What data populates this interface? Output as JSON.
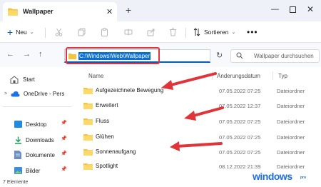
{
  "tab": {
    "title": "Wallpaper",
    "close": "✕",
    "add": "+"
  },
  "window": {
    "minimize": "—",
    "close": "✕"
  },
  "toolbar": {
    "new_label": "Neu",
    "new_icon": "+",
    "new_caret": "⌄",
    "sort_label": "Sortieren",
    "sort_caret": "⌄",
    "more": "•••",
    "icons": [
      "scissors-icon",
      "copy-icon",
      "paste-icon",
      "rename-icon",
      "share-icon",
      "delete-icon",
      "sort-icon"
    ]
  },
  "nav": {
    "back": "←",
    "forward": "→",
    "up": "↑",
    "address": "C:\\Windows\\Web\\Wallpaper",
    "refresh": "↻",
    "search_placeholder": "Wallpaper durchsuchen"
  },
  "sidebar": {
    "items": [
      {
        "label": "Start",
        "icon": "home-icon"
      },
      {
        "label": "OneDrive - Pers",
        "icon": "cloud-icon"
      },
      {
        "label": "Desktop",
        "icon": "desktop-icon"
      },
      {
        "label": "Downloads",
        "icon": "download-icon"
      },
      {
        "label": "Dokumente",
        "icon": "documents-icon"
      },
      {
        "label": "Bilder",
        "icon": "pictures-icon"
      }
    ],
    "pin": "📌"
  },
  "columns": {
    "name": "Name",
    "date": "Änderungsdatum",
    "type": "Typ"
  },
  "rows": [
    {
      "name": "Aufgezeichnete Bewegung",
      "date": "07.05.2022 07:25",
      "type": "Dateiordner"
    },
    {
      "name": "Erweitert",
      "date": "07.05.2022 12:37",
      "type": "Dateiordner"
    },
    {
      "name": "Fluss",
      "date": "07.05.2022 07:25",
      "type": "Dateiordner"
    },
    {
      "name": "Glühen",
      "date": "07.05.2022 07:25",
      "type": "Dateiordner"
    },
    {
      "name": "Sonnenaufgang",
      "date": "07.05.2022 07:25",
      "type": "Dateiordner"
    },
    {
      "name": "Spotlight",
      "date": "08.12.2022 21:39",
      "type": "Dateiordner"
    }
  ],
  "status": {
    "text": "7 Elemente"
  },
  "watermark": {
    "text": "windows",
    "suffix": "pro"
  },
  "colors": {
    "accent": "#005fb8",
    "folder": "#f5c542",
    "annotation": "#e0343a",
    "selection": "#0a6fd3"
  }
}
